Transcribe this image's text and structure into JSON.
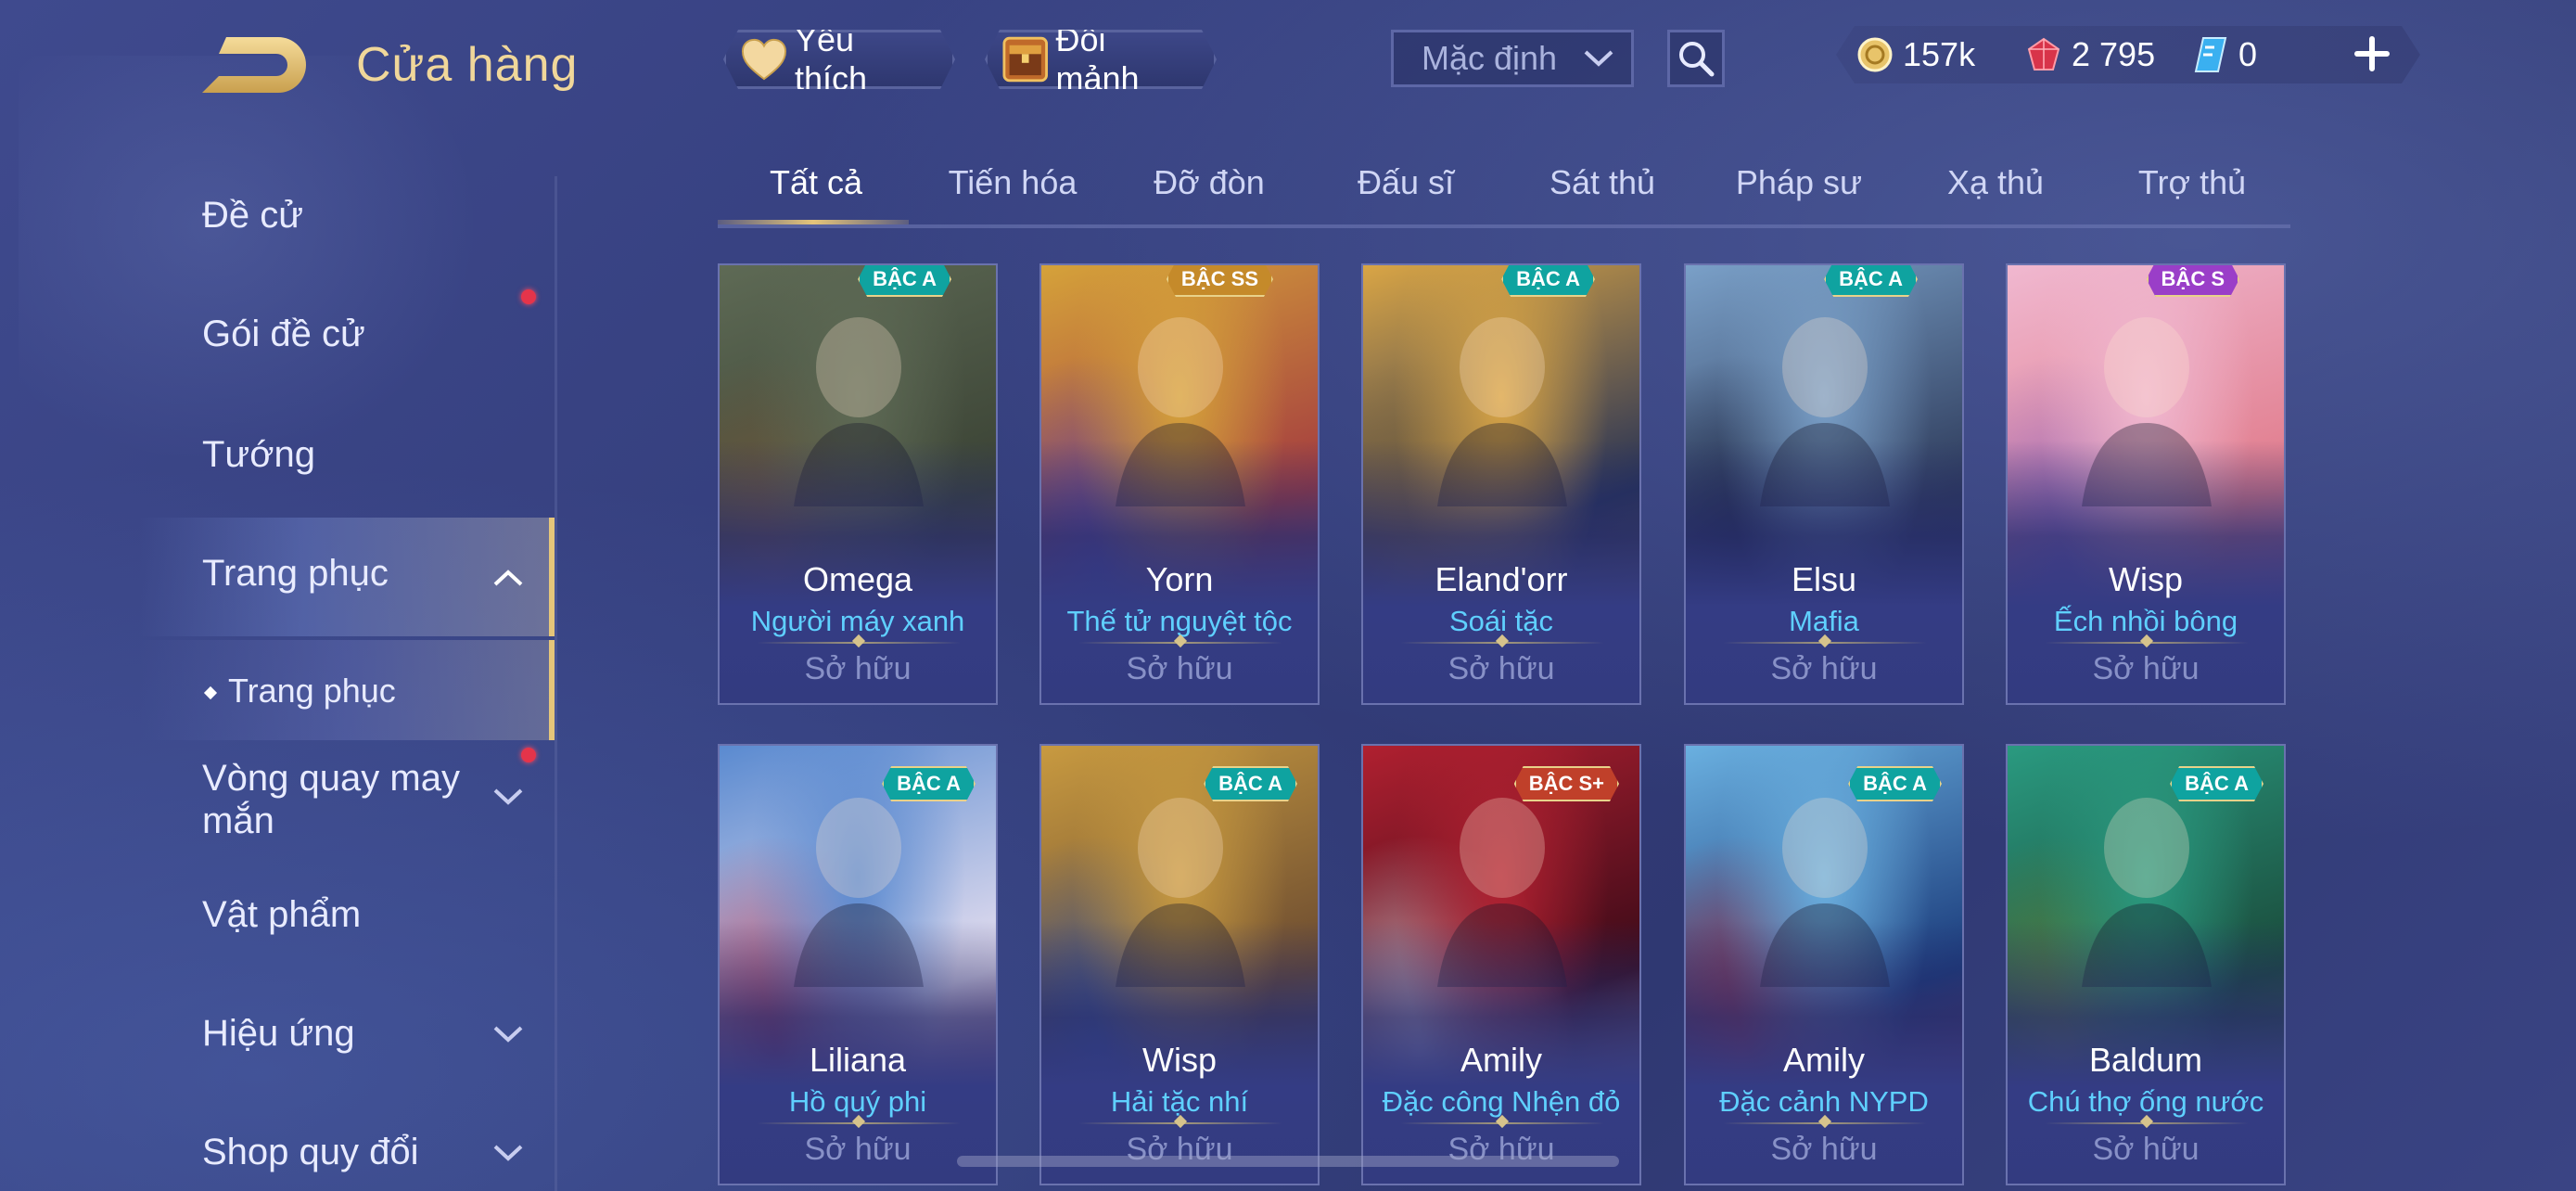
{
  "header": {
    "title": "Cửa hàng",
    "favorite_label": "Yêu thích",
    "shard_label": "Đổi mảnh",
    "sort_value": "Mặc định"
  },
  "currency": {
    "gold": "157k",
    "ruby": "2 795",
    "voucher": "0"
  },
  "sidebar": {
    "items": [
      {
        "label": "Đề cử"
      },
      {
        "label": "Gói đề cử"
      },
      {
        "label": "Tướng"
      },
      {
        "label": "Trang phục"
      },
      {
        "label": "Trang phục"
      },
      {
        "label": "Vòng quay may mắn"
      },
      {
        "label": "Vật phẩm"
      },
      {
        "label": "Hiệu ứng"
      },
      {
        "label": "Shop quy đổi"
      }
    ]
  },
  "tabs": [
    {
      "label": "Tất cả"
    },
    {
      "label": "Tiến hóa"
    },
    {
      "label": "Đỡ đòn"
    },
    {
      "label": "Đấu sĩ"
    },
    {
      "label": "Sát thủ"
    },
    {
      "label": "Pháp sư"
    },
    {
      "label": "Xạ thủ"
    },
    {
      "label": "Trợ thủ"
    }
  ],
  "cards": [
    {
      "hero": "Omega",
      "skin": "Người máy xanh",
      "status": "Sở hữu",
      "tier": "BẬC A",
      "tier_color": "#0fa3a0",
      "art": [
        "#5e6a55",
        "#3a4234",
        "#7d5a3a"
      ]
    },
    {
      "hero": "Yorn",
      "skin": "Thế tử nguyệt tộc",
      "status": "Sở hữu",
      "tier": "BẬC SS",
      "tier_color": "#c58a2a",
      "art": [
        "#d5a23a",
        "#a33a3f",
        "#5a4aa8"
      ]
    },
    {
      "hero": "Eland'orr",
      "skin": "Soái tặc",
      "status": "Sở hữu",
      "tier": "BẬC A",
      "tier_color": "#0fa3a0",
      "art": [
        "#d9a545",
        "#243055",
        "#8a6a30"
      ]
    },
    {
      "hero": "Elsu",
      "skin": "Mafia",
      "status": "Sở hữu",
      "tier": "BẬC A",
      "tier_color": "#0fa3a0",
      "art": [
        "#7aa0c8",
        "#2d3a5a",
        "#1c2440"
      ]
    },
    {
      "hero": "Wisp",
      "skin": "Ếch nhồi bông",
      "status": "Sở hữu",
      "tier": "BẬC S",
      "tier_color": "#9a3ec8",
      "art": [
        "#f0b8d0",
        "#e07a8a",
        "#8a68c8"
      ]
    },
    {
      "hero": "Liliana",
      "skin": "Hồ quý phi",
      "status": "Sở hữu",
      "tier": "BẬC A",
      "tier_color": "#0fa3a0",
      "art": [
        "#5a8ad0",
        "#e8e0f0",
        "#b03050"
      ]
    },
    {
      "hero": "Wisp",
      "skin": "Hải tặc nhí",
      "status": "Sở hữu",
      "tier": "BẬC A",
      "tier_color": "#0fa3a0",
      "art": [
        "#c89a40",
        "#6a4a30",
        "#3a5aa0"
      ]
    },
    {
      "hero": "Amily",
      "skin": "Đặc công Nhện đỏ",
      "status": "Sở hữu",
      "tier": "BẬC S+",
      "tier_color": "#c0402a",
      "art": [
        "#b02030",
        "#3a0a18",
        "#e8d0d8"
      ]
    },
    {
      "hero": "Amily",
      "skin": "Đặc cảnh NYPD",
      "status": "Sở hữu",
      "tier": "BẬC A",
      "tier_color": "#0fa3a0",
      "art": [
        "#6ab0e0",
        "#1a3a7a",
        "#b03040"
      ]
    },
    {
      "hero": "Baldum",
      "skin": "Chú thợ ống nước",
      "status": "Sở hữu",
      "tier": "BẬC A",
      "tier_color": "#0fa3a0",
      "art": [
        "#2a9a80",
        "#1a4a3a",
        "#6a8a3a"
      ]
    }
  ]
}
